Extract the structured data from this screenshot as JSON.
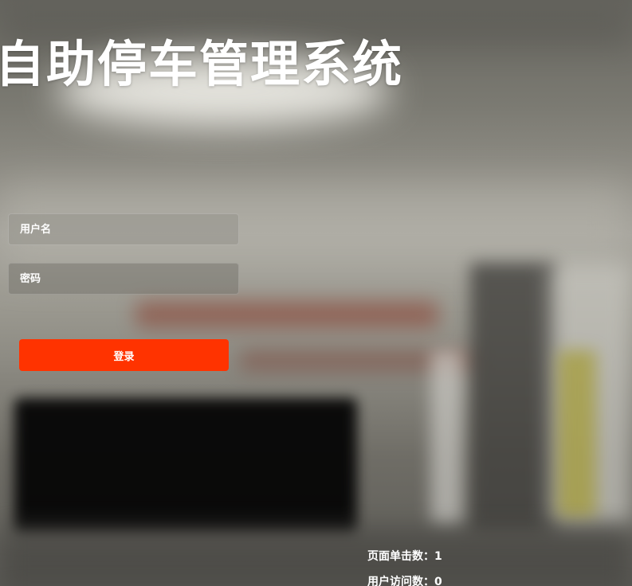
{
  "app": {
    "title": "自助停车管理系统"
  },
  "login_form": {
    "username_placeholder": "用户名",
    "password_placeholder": "密码",
    "submit_label": "登录"
  },
  "stats": {
    "page_clicks_label": "页面单击数：",
    "page_clicks_value": "1",
    "user_visits_label": "用户访问数：",
    "user_visits_value": "0"
  },
  "colors": {
    "accent": "#ff3300",
    "text": "#ffffff"
  }
}
